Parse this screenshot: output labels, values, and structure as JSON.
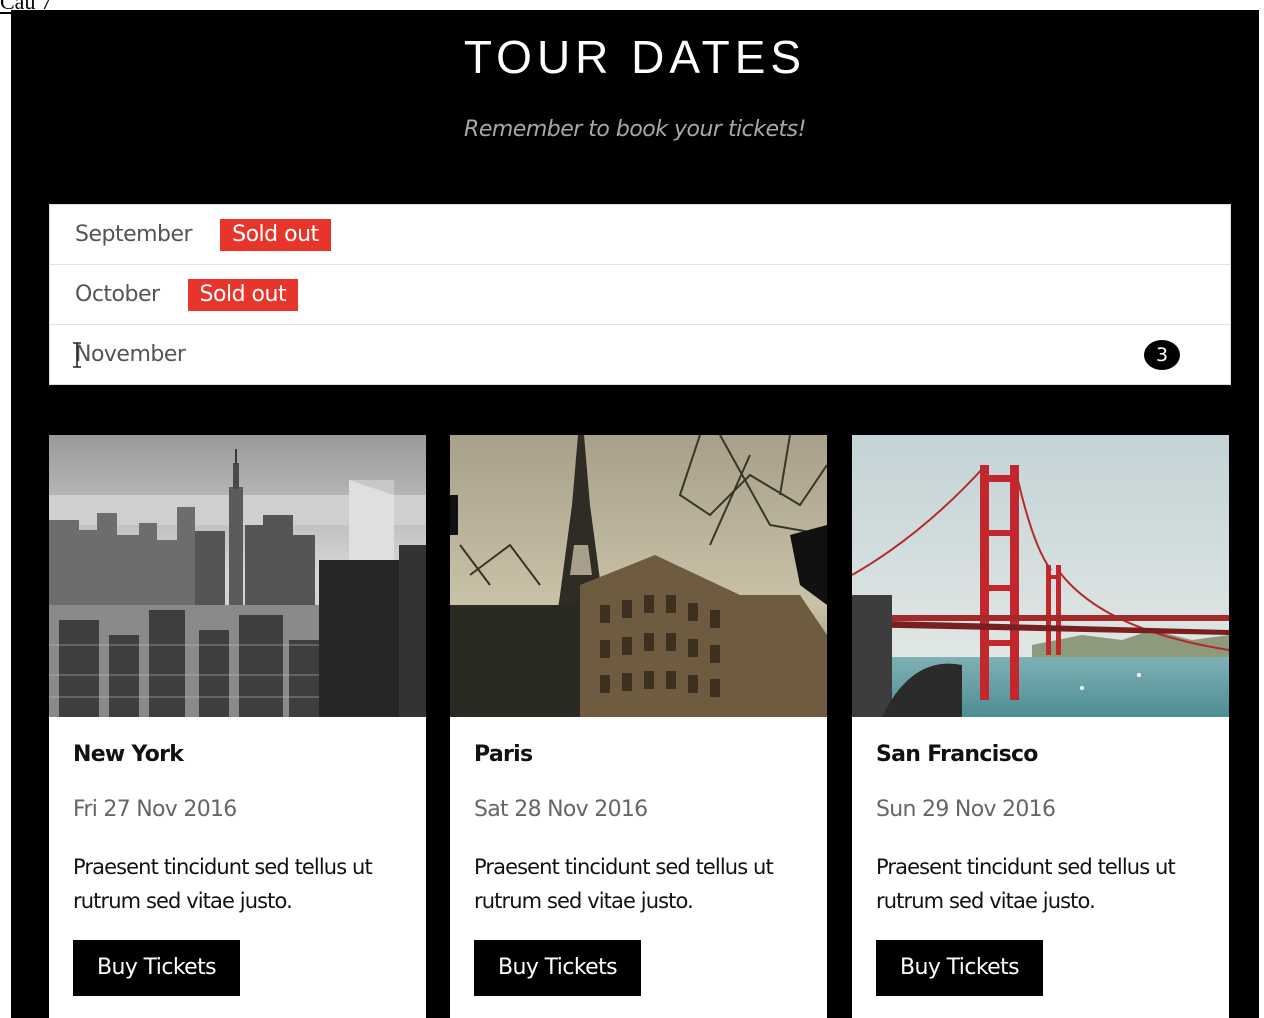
{
  "corner_label": "Cau 7",
  "header": {
    "title": "TOUR DATES",
    "subtitle": "Remember to book your tickets!"
  },
  "months": [
    {
      "name": "September",
      "badge": "Sold out"
    },
    {
      "name": "October",
      "badge": "Sold out"
    },
    {
      "name": "November",
      "count": "3"
    }
  ],
  "cards": [
    {
      "image": "new-york-skyline-photo",
      "city": "New York",
      "date": "Fri 27 Nov 2016",
      "description": "Praesent tincidunt sed tellus ut rutrum sed vitae justo.",
      "button": "Buy Tickets"
    },
    {
      "image": "paris-eiffel-tower-photo",
      "city": "Paris",
      "date": "Sat 28 Nov 2016",
      "description": "Praesent tincidunt sed tellus ut rutrum sed vitae justo.",
      "button": "Buy Tickets"
    },
    {
      "image": "san-francisco-golden-gate-photo",
      "city": "San Francisco",
      "date": "Sun 29 Nov 2016",
      "description": "Praesent tincidunt sed tellus ut rutrum sed vitae justo.",
      "button": "Buy Tickets"
    }
  ],
  "colors": {
    "background": "#000000",
    "sold_out": "#e8352b",
    "card": "#ffffff",
    "button": "#000000"
  }
}
